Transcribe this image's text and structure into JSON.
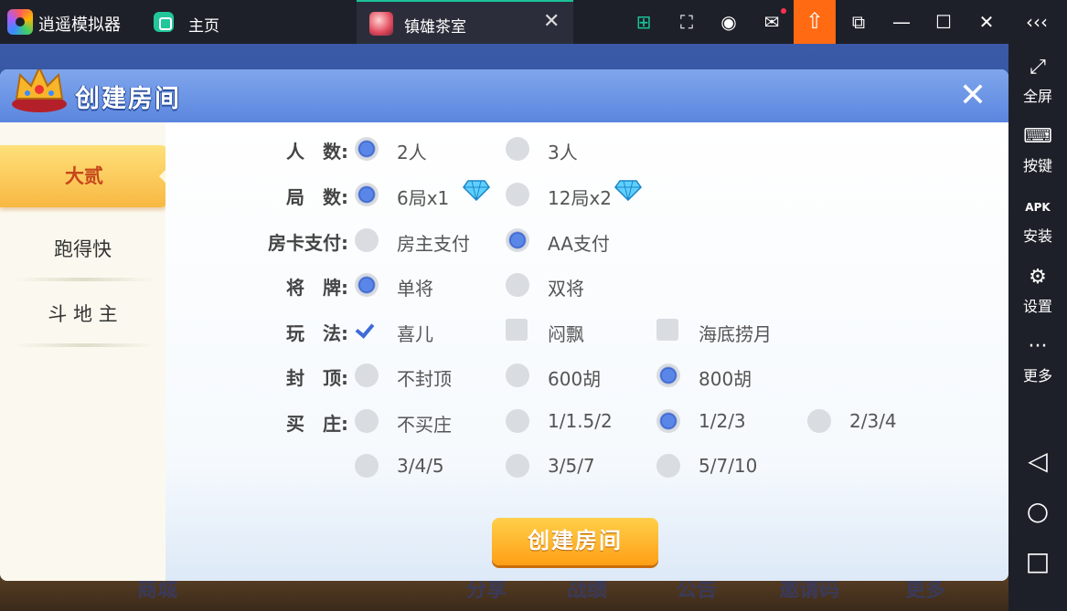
{
  "emulator": {
    "app_name": "逍遥模拟器",
    "home_label": "主页",
    "tab_title": "镇雄茶室",
    "sidebar": [
      {
        "icon": "fullscreen-icon",
        "label": "全屏"
      },
      {
        "icon": "keyboard-icon",
        "label": "按键"
      },
      {
        "icon": "apk-icon",
        "label": "安装"
      },
      {
        "icon": "gear-icon",
        "label": "设置"
      },
      {
        "icon": "more-icon",
        "label": "更多"
      }
    ]
  },
  "game_bottom": {
    "items": [
      "商城",
      "分享",
      "战绩",
      "公告",
      "邀请码",
      "更多"
    ]
  },
  "dialog": {
    "title": "创建房间",
    "nav": [
      {
        "label": "大贰",
        "active": true
      },
      {
        "label": "跑得快",
        "active": false
      },
      {
        "label": "斗 地 主",
        "active": false
      }
    ],
    "rows": [
      {
        "label": "人　数:",
        "type": "radio",
        "options": [
          {
            "text": "2人",
            "on": true
          },
          {
            "text": "3人",
            "on": false
          }
        ]
      },
      {
        "label": "局　数:",
        "type": "radio",
        "options": [
          {
            "text": "6局x1",
            "on": true,
            "gem": true
          },
          {
            "text": "12局x2",
            "on": false,
            "gem": true
          }
        ]
      },
      {
        "label": "房卡支付:",
        "type": "radio",
        "options": [
          {
            "text": "房主支付",
            "on": false
          },
          {
            "text": "AA支付",
            "on": true
          }
        ]
      },
      {
        "label": "将　牌:",
        "type": "radio",
        "options": [
          {
            "text": "单将",
            "on": true
          },
          {
            "text": "双将",
            "on": false
          }
        ]
      },
      {
        "label": "玩　法:",
        "type": "check",
        "options": [
          {
            "text": "喜儿",
            "on": true
          },
          {
            "text": "闷飘",
            "on": false
          },
          {
            "text": "海底捞月",
            "on": false
          }
        ]
      },
      {
        "label": "封　顶:",
        "type": "radio",
        "options": [
          {
            "text": "不封顶",
            "on": false
          },
          {
            "text": "600胡",
            "on": false
          },
          {
            "text": "800胡",
            "on": true
          }
        ]
      },
      {
        "label": "买　庄:",
        "type": "radio",
        "options": [
          {
            "text": "不买庄",
            "on": false
          },
          {
            "text": "1/1.5/2",
            "on": false
          },
          {
            "text": "1/2/3",
            "on": true
          },
          {
            "text": "2/3/4",
            "on": false
          }
        ]
      },
      {
        "label": "",
        "type": "radio",
        "options": [
          {
            "text": "3/4/5",
            "on": false
          },
          {
            "text": "3/5/7",
            "on": false
          },
          {
            "text": "5/7/10",
            "on": false
          }
        ]
      }
    ],
    "create_button": "创建房间"
  }
}
